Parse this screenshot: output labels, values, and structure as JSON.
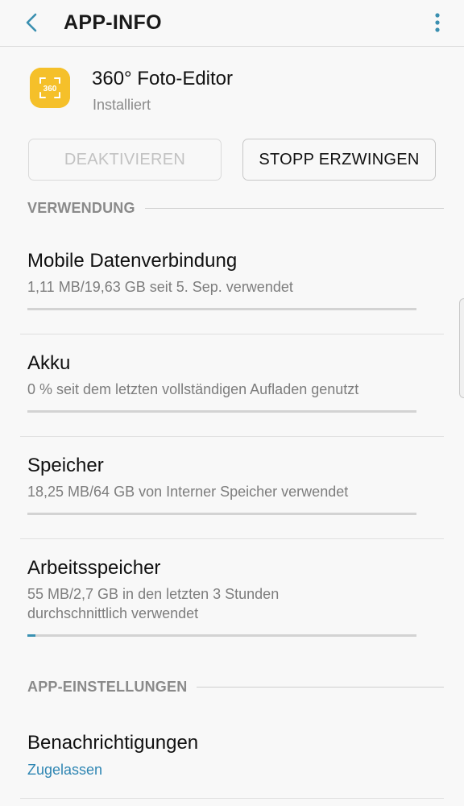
{
  "appbar": {
    "title": "APP-INFO",
    "back_icon": "chevron-left-icon",
    "more_icon": "more-vert-icon",
    "accent_color": "#3a8fb0"
  },
  "app": {
    "name": "360° Foto-Editor",
    "status": "Installiert",
    "icon_label": "360",
    "icon_color": "#f5c02a"
  },
  "actions": {
    "disable_label": "DEAKTIVIEREN",
    "force_stop_label": "STOPP ERZWINGEN"
  },
  "sections": {
    "usage_header": "VERWENDUNG",
    "settings_header": "APP-EINSTELLUNGEN"
  },
  "usage_items": [
    {
      "title": "Mobile Datenverbindung",
      "subtitle": "1,11 MB/19,63 GB seit 5. Sep. verwendet",
      "progress": 0.0
    },
    {
      "title": "Akku",
      "subtitle": "0 % seit dem letzten vollständigen Aufladen genutzt",
      "progress": 0.0
    },
    {
      "title": "Speicher",
      "subtitle": "18,25 MB/64 GB von Interner Speicher verwendet",
      "progress": 0.0
    },
    {
      "title": "Arbeitsspeicher",
      "subtitle_line1": "55 MB/2,7 GB in den letzten 3 Stunden",
      "subtitle_line2": "durchschnittlich verwendet",
      "progress": 0.02
    }
  ],
  "settings_items": [
    {
      "title": "Benachrichtigungen",
      "subtitle": "Zugelassen"
    }
  ]
}
